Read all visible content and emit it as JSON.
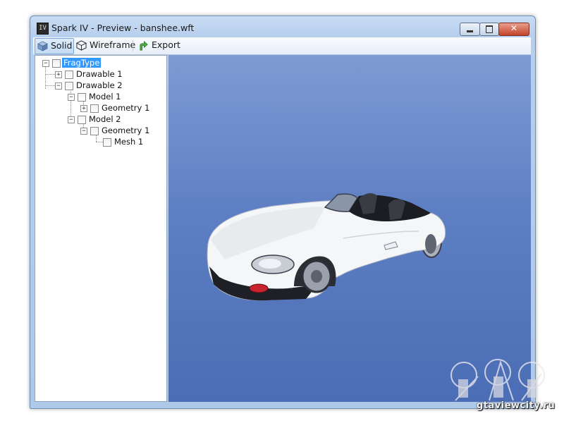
{
  "window": {
    "title": "Spark IV - Preview - banshee.wft",
    "app_icon_text": "IV",
    "close_glyph": "✕"
  },
  "toolbar": {
    "solid_label": "Solid",
    "wireframe_label": "Wireframe",
    "export_label": "Export"
  },
  "tree": {
    "nodes": [
      {
        "label": "FragType",
        "expander": "−",
        "selected": true
      },
      {
        "label": "Drawable 1",
        "expander": "+"
      },
      {
        "label": "Drawable 2",
        "expander": "−"
      },
      {
        "label": "Model 1",
        "expander": "−"
      },
      {
        "label": "Geometry 1",
        "expander": "+"
      },
      {
        "label": "Model 2",
        "expander": "−"
      },
      {
        "label": "Geometry 1",
        "expander": "−"
      },
      {
        "label": "Mesh 1",
        "expander": ""
      }
    ]
  },
  "viewport": {
    "background_top": "#7d9bd4",
    "background_bottom": "#4b6db5",
    "model_color": "#ffffff"
  },
  "watermark": {
    "text": "gtaviewcity.ru"
  },
  "colors": {
    "selection": "#3399ff",
    "close_button": "#c2432a"
  }
}
